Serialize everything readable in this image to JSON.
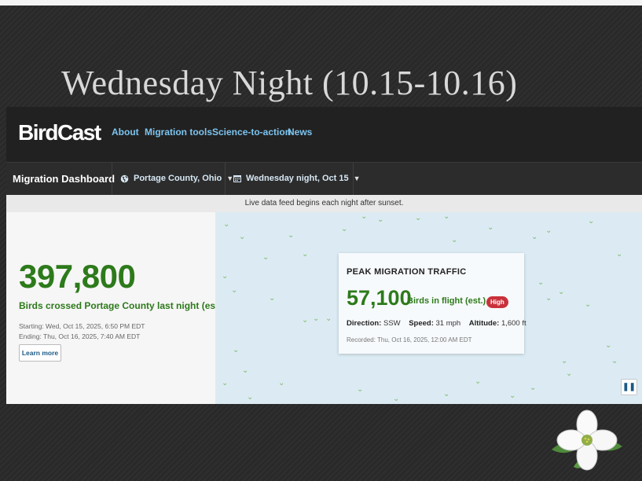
{
  "slide": {
    "title": "Wednesday Night (10.15-10.16)"
  },
  "nav": {
    "logo": "BirdCast",
    "links": [
      "About",
      "Migration tools",
      "Science-to-action",
      "News"
    ]
  },
  "dashboard": {
    "title": "Migration Dashboard",
    "location": "Portage County, Ohio",
    "date": "Wednesday night, Oct 15",
    "feed_notice": "Live data feed begins each night after sunset."
  },
  "summary": {
    "count": "397,800",
    "label": "Birds crossed Portage County last night (est.)",
    "starting": "Starting: Wed, Oct 15, 2025, 6:50 PM EDT",
    "ending": "Ending: Thu, Oct 16, 2025, 7:40 AM EDT",
    "learn_more": "Learn more"
  },
  "peak": {
    "title": "PEAK MIGRATION TRAFFIC",
    "value": "57,100",
    "label": "Birds in flight (est.)",
    "badge": "High",
    "direction_label": "Direction:",
    "direction": "SSW",
    "speed_label": "Speed:",
    "speed": "31 mph",
    "altitude_label": "Altitude:",
    "altitude": "1,600 ft",
    "recorded": "Recorded: Thu, Oct 16, 2025, 12:00 AM EDT"
  },
  "icons": {
    "location": "globe-icon",
    "date": "calendar-icon",
    "pause": "pause-icon",
    "decoration": "dogwood-flower-icon"
  },
  "colors": {
    "accent_green": "#2d7a1b",
    "nav_link": "#7cc4ef",
    "badge_red": "#c9313a",
    "map_bg": "#dcebf3"
  }
}
